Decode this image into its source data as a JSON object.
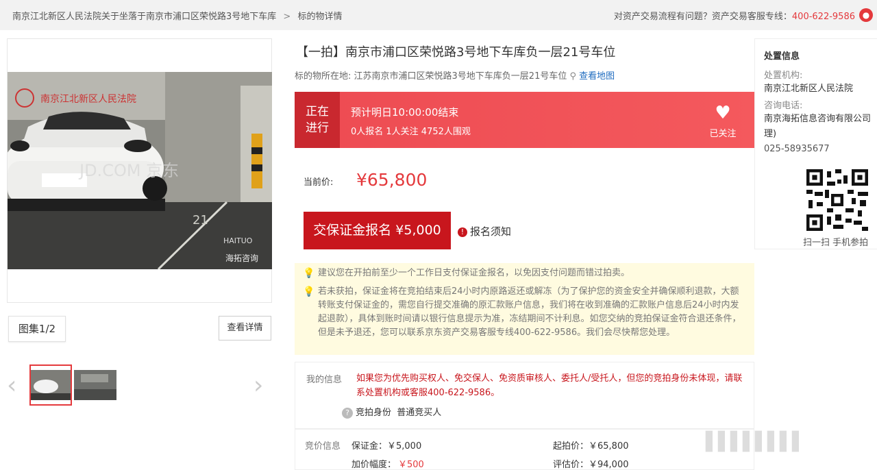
{
  "breadcrumb": {
    "parent": "南京江北新区人民法院关于坐落于南京市浦口区荣悦路3号地下车库",
    "separator": ">",
    "current": "标的物详情"
  },
  "help": {
    "text": "对资产交易流程有问题？资产交易客服专线：",
    "phone": "400-622-9586"
  },
  "gallery": {
    "watermark_court": "南京江北新区人民法院",
    "watermark_site": "JD.COM 京东",
    "watermark_bottom": "海拓咨询",
    "stall_marking": "21",
    "album_label": "图集1/2",
    "detail_button": "查看详情"
  },
  "item": {
    "title": "【一拍】南京市浦口区荣悦路3号地下车库负一层21号车位",
    "location_label": "标的物所在地:",
    "location": "江苏南京市浦口区荣悦路3号地下车库负一层21号车位",
    "map_link": "查看地图"
  },
  "status": {
    "tag_line1": "正在",
    "tag_line2": "进行",
    "ends": "预计明日10:00:00结束",
    "stats": "0人报名  1人关注  4752人围观",
    "follow_label": "已关注"
  },
  "price": {
    "label": "当前价:",
    "value": "¥65,800"
  },
  "signup": {
    "button": "交保证金报名 ¥5,000",
    "notice": "报名须知"
  },
  "tips": [
    "建议您在开拍前至少一个工作日支付保证金报名，以免因支付问题而错过拍卖。",
    "若未获拍，保证金将在竞拍结束后24小时内原路返还或解冻（为了保护您的资金安全并确保顺利退款，大额转账支付保证金的，需您自行提交准确的原汇款账户信息，我们将在收到准确的汇款账户信息后24小时内发起退款），具体到账时间请以银行信息提示为准，冻结期间不计利息。如您交纳的竞拍保证金符合退还条件，但是未予退还，您可以联系京东资产交易客服专线400-622-9586。我们会尽快帮您处理。"
  ],
  "myinfo": {
    "label": "我的信息",
    "message": "如果您为优先购买权人、免交保人、免资质审核人、委托人/受托人，但您的竞拍身份未体现，请联系处置机构或客服400-622-9586。",
    "role_label": "竞拍身份",
    "role_value": "普通竞买人"
  },
  "bidinfo": {
    "label": "竞价信息",
    "deposit": "保证金：￥5,000",
    "start_price": "起拍价：￥65,800",
    "increment_label": "加价幅度：",
    "increment_value": "￥500",
    "appraisal": "评估价：￥94,000"
  },
  "disposal": {
    "heading": "处置信息",
    "org_label": "处置机构:",
    "org": "南京江北新区人民法院",
    "contact_label": "咨询电话:",
    "contact_org": "南京海拓信息咨询有限公司",
    "contact_paren": "理)",
    "contact_phone": "025-58935677",
    "scan_text": "扫一扫 手机参拍"
  },
  "colors": {
    "accent": "#e4393c",
    "button": "#c8161d",
    "status_bg": "#ef4f55",
    "tips_bg": "#fffbe0"
  }
}
